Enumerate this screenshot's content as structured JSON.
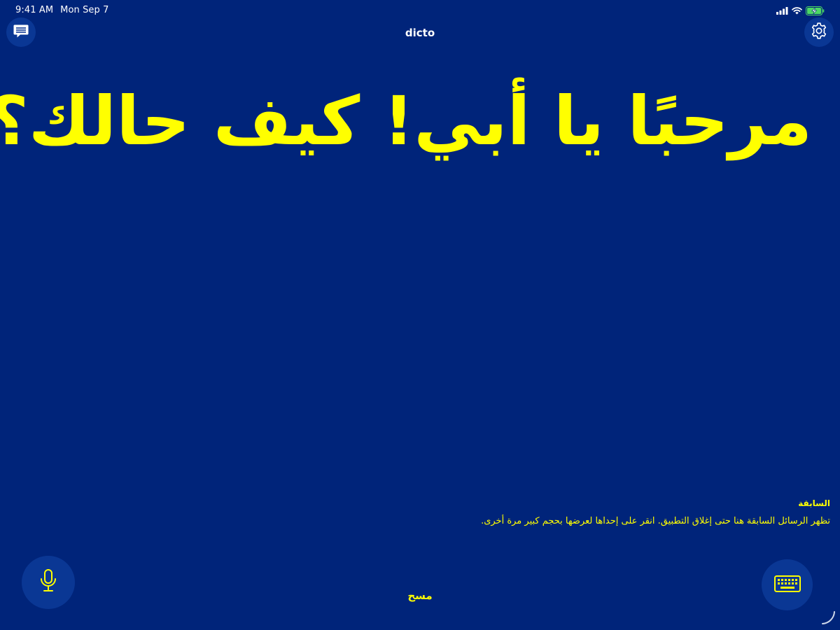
{
  "status_bar": {
    "time": "9:41 AM",
    "date": "Mon Sep 7",
    "icons": [
      "cellular-signal-icon",
      "wifi-icon",
      "battery-charging-icon"
    ]
  },
  "nav": {
    "title": "dicto",
    "left_icon": "message-history-icon",
    "right_icon": "gear-icon"
  },
  "main": {
    "message": "مرحبًا يا أبي! كيف حالك؟"
  },
  "previous": {
    "heading": "السابقة",
    "description": "تظهر الرسائل السابقة هنا حتى إغلاق التطبيق. انقر على إحداها لعرضها بحجم كبير مرة أخرى."
  },
  "bottom": {
    "clear_label": "مسح",
    "mic_icon": "microphone-icon",
    "keyboard_icon": "keyboard-icon"
  },
  "colors": {
    "background": "#00247a",
    "button_background": "#0a3794",
    "accent": "#ffff00",
    "text_white": "#ffffff"
  }
}
